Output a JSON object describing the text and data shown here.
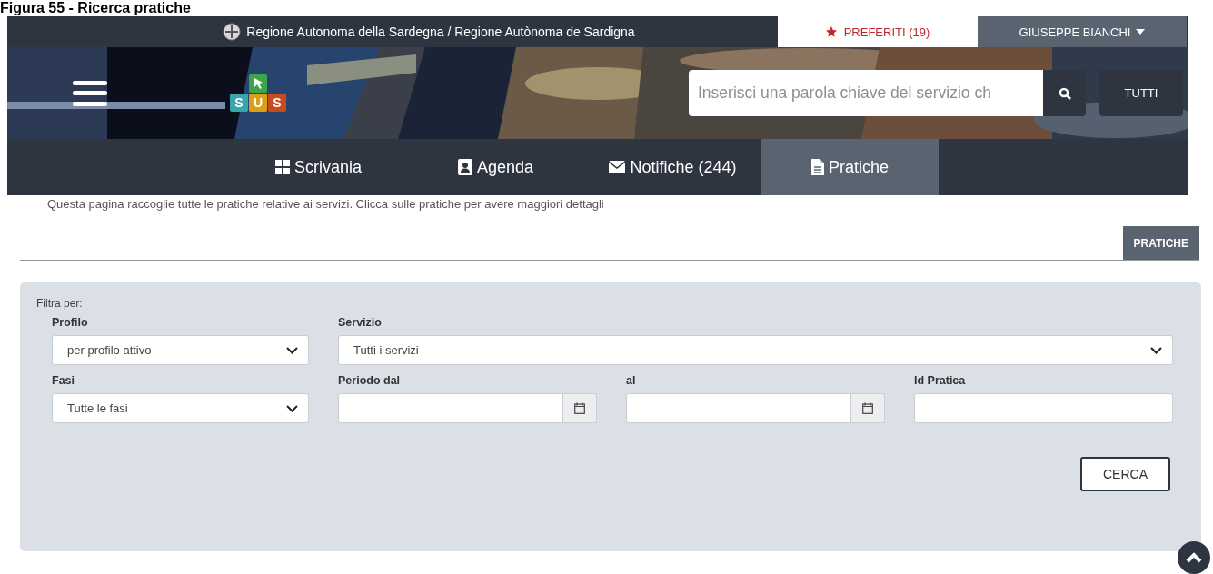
{
  "caption": "Figura 55 - Ricerca pratiche",
  "top_bar": {
    "title": "Regione Autonoma della Sardegna / Regione Autònoma de Sardigna",
    "favorites": "PREFERITI (19)",
    "user": "GIUSEPPE BIANCHI"
  },
  "hero": {
    "logo_letters": [
      "S",
      "U",
      "S"
    ],
    "search": {
      "placeholder": "Inserisci una parola chiave del servizio ch"
    },
    "scope_button": "TUTTI"
  },
  "nav": [
    {
      "label": "Scrivania",
      "kind": "grid",
      "selected": false
    },
    {
      "label": "Agenda",
      "kind": "contact",
      "selected": false
    },
    {
      "label": "Notifiche (244)",
      "kind": "mail",
      "selected": false
    },
    {
      "label": "Pratiche",
      "kind": "document",
      "selected": true
    }
  ],
  "intro": "Questa pagina raccoglie tutte le pratiche relative ai servizi. Clicca sulle pratiche per avere maggiori dettagli",
  "section_tabs": [
    {
      "label": "PRATICHE",
      "selected": true
    }
  ],
  "filters": {
    "title": "Filtra per:",
    "rows": [
      [
        {
          "label": "Profilo",
          "kind": "select",
          "value": "per profilo attivo"
        },
        {
          "label": "Servizio",
          "kind": "select",
          "value": "Tutti i servizi"
        }
      ],
      [
        {
          "label": "Fasi",
          "kind": "select",
          "value": "Tutte le fasi"
        },
        {
          "label": "Periodo dal",
          "kind": "date"
        },
        {
          "label": "al",
          "kind": "date"
        },
        {
          "label": "Id Pratica",
          "kind": "text"
        }
      ]
    ],
    "submit": "CERCA"
  }
}
